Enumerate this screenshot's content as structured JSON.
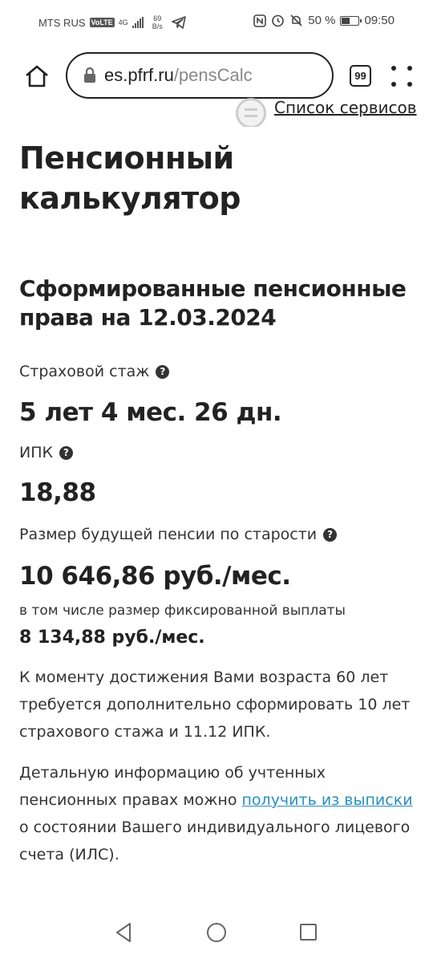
{
  "status_bar": {
    "carrier": "MTS RUS",
    "volte": "VoLTE",
    "network": "4G",
    "speed_value": "69",
    "speed_unit": "B/s",
    "battery_percent": "50 %",
    "battery_level": 0.5,
    "time": "09:50"
  },
  "browser": {
    "url_domain": "es.pfrf.ru",
    "url_path": "/pensCalc",
    "tab_count": "99"
  },
  "services_link": "Список сервисов",
  "page_title": "Пенсионный калькулятор",
  "section_title": "Сформированные пенсионные права на 12.03.2024",
  "insurance_experience": {
    "label": "Страховой стаж",
    "value": "5 лет 4 мес. 26 дн."
  },
  "ipk": {
    "label": "ИПК",
    "value": "18,88"
  },
  "future_pension": {
    "label": "Размер будущей пенсии по старости",
    "value": "10 646,86 руб./мес.",
    "fixed_label": "в том числе размер фиксированной выплаты",
    "fixed_value": "8 134,88 руб./мес."
  },
  "requirement_text": "К моменту достижения Вами возраста 60 лет требуется дополнительно сформировать 10 лет страхового стажа и 11.12 ИПК.",
  "info_paragraph": {
    "before": "Детальную информацию об учтенных пенсионных правах можно ",
    "link": "получить из выписки",
    "after": " о состоянии Вашего индивидуального лицевого счета (ИЛС)."
  },
  "colors": {
    "link": "#2a8fbd",
    "text": "#222222"
  }
}
